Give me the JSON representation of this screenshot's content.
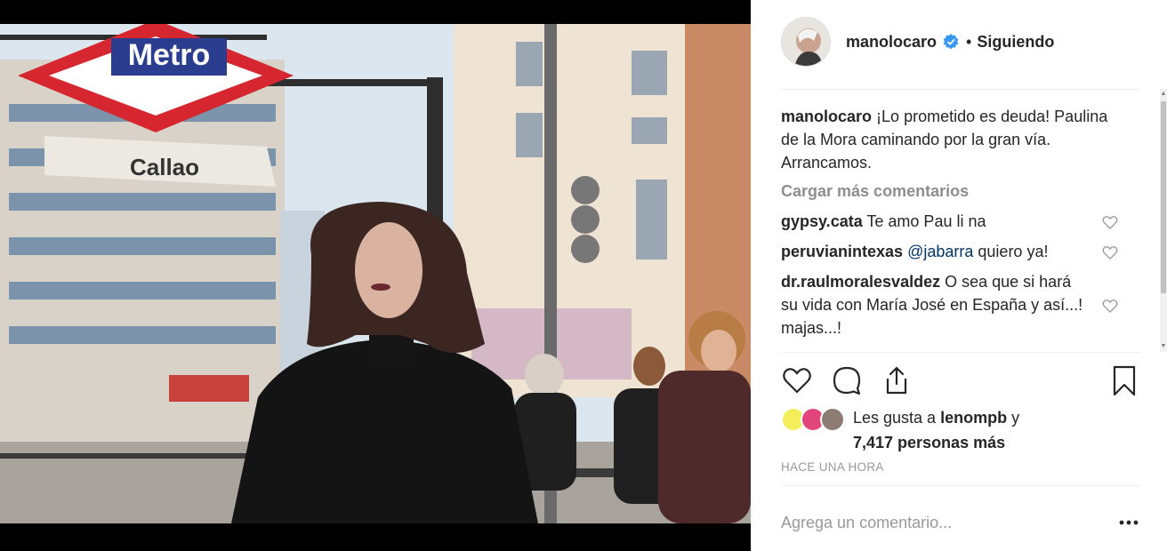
{
  "post": {
    "author": "manolocaro",
    "follow_status": "Siguiendo",
    "separator": "•"
  },
  "caption": {
    "username": "manolocaro",
    "text": "¡Lo prometido es deuda! Paulina de la Mora caminando por la gran vía. Arrancamos."
  },
  "load_more_label": "Cargar más comentarios",
  "comments": [
    {
      "username": "gypsy.cata",
      "text": "Te amo Pau li na"
    },
    {
      "username": "peruvianintexas",
      "mention": "@jabarra",
      "text": "quiero ya!"
    },
    {
      "username": "dr.raulmoralesvaldez",
      "text": "O sea que si hará su vida con María José en España y así...! majas...!"
    }
  ],
  "likes": {
    "prefix": "Les gusta a",
    "user": "lenompb",
    "conjunction": "y",
    "count_text": "7,417 personas más"
  },
  "timestamp": "Hace una hora",
  "add_comment": {
    "placeholder": "Agrega un comentario..."
  },
  "photo": {
    "sign_metro": "Metro",
    "sign_street": "Callao"
  },
  "colors": {
    "text": "#262626",
    "muted": "#8e8e8e",
    "mention": "#003569",
    "verified": "#3897f0",
    "metro_red": "#d6262f",
    "metro_blue": "#2a3d8f"
  },
  "icons": [
    "heart-icon",
    "comment-icon",
    "share-icon",
    "bookmark-icon",
    "more-options-icon",
    "verified-badge-icon"
  ]
}
